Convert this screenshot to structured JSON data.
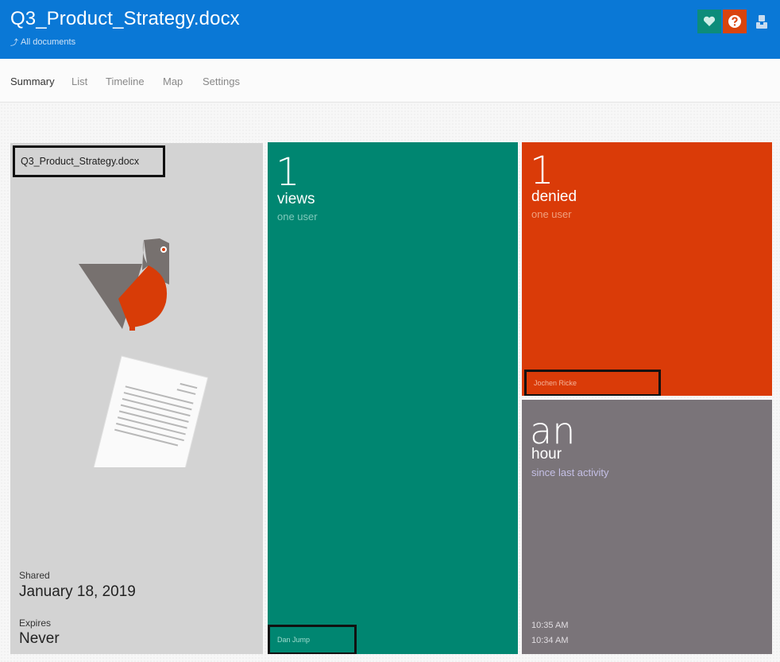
{
  "header": {
    "title": "Q3_Product_Strategy.docx",
    "back_link": "All documents"
  },
  "tabs": [
    {
      "label": "Summary"
    },
    {
      "label": "List"
    },
    {
      "label": "Timeline"
    },
    {
      "label": "Map"
    },
    {
      "label": "Settings"
    }
  ],
  "active_tab": "Summary",
  "document_tile": {
    "file_name": "Q3_Product_Strategy.docx",
    "shared_label": "Shared",
    "shared_value": "January 18, 2019",
    "expires_label": "Expires",
    "expires_value": "Never"
  },
  "views_tile": {
    "count": "1",
    "label": "views",
    "sub": "one user",
    "user": "Dan Jump",
    "color": "#008671"
  },
  "denied_tile": {
    "count": "1",
    "label": "denied",
    "sub": "one user",
    "user": "Jochen Ricke",
    "color": "#da3b08"
  },
  "activity_tile": {
    "big": "an",
    "label": "hour",
    "sub": "since last activity",
    "times": [
      "10:35 AM",
      "10:34 AM"
    ],
    "color": "#7a7479"
  },
  "colors": {
    "header_blue": "#0a78d6",
    "favorite_teal": "#0c8c7a",
    "help_orange": "#d9440d"
  },
  "icons": {
    "favorite": "heart-icon",
    "help": "question-icon",
    "user": "user-icon",
    "back": "return-arrow-icon"
  }
}
